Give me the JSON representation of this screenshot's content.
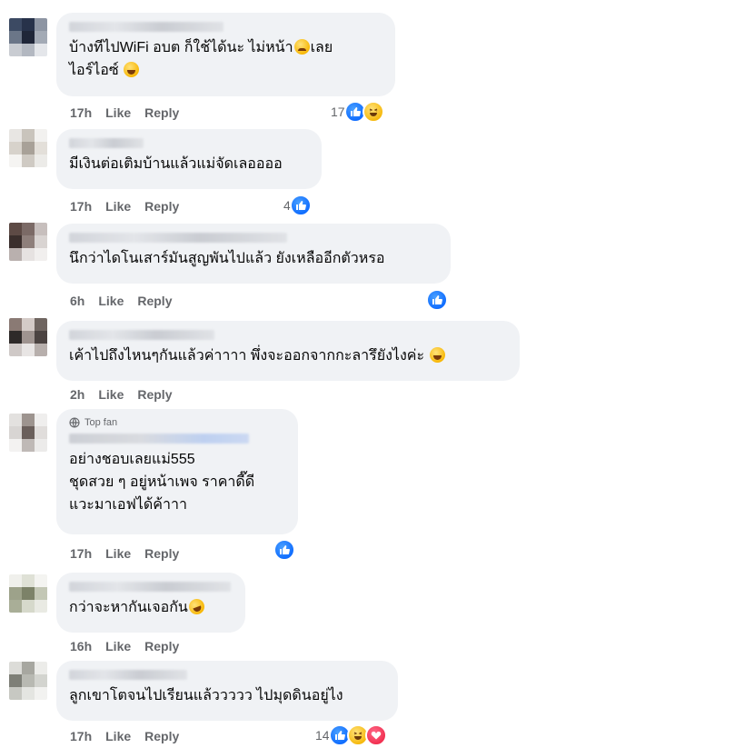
{
  "labels": {
    "like": "Like",
    "reply": "Reply",
    "top_fan": "Top fan"
  },
  "comments": [
    {
      "text_lines": [
        "บ้างทีไปWiFi อบต ก็ใช้ได้นะ ไม่หน้า",
        "เลย",
        "ไอร์ไอซ์ "
      ],
      "time": "17h",
      "reaction_count": "17",
      "reactions": [
        "like-icon",
        "haha-icon"
      ]
    },
    {
      "text_lines": [
        "มีเงินต่อเติมบ้านแล้วแม่จัดเลออออ"
      ],
      "time": "17h",
      "reaction_count": "4",
      "reactions": [
        "like-icon"
      ]
    },
    {
      "text_lines": [
        "นึกว่าไดโนเสาร์มันสูญพันไปแล้ว ยังเหลืออีกตัวหรอ"
      ],
      "time": "6h",
      "reaction_count": "",
      "reactions": [
        "like-icon"
      ]
    },
    {
      "text_lines": [
        "เค้าไปถึงไหนๆกันแล้วค่าาาา  พึ่งจะออกจากกะลารึยังไงค่ะ "
      ],
      "time": "2h",
      "reaction_count": "",
      "reactions": []
    },
    {
      "text_lines": [
        "อย่างชอบเลยแม่555",
        "ชุดสวย ๆ อยู่หน้าเพจ ราคาดี๊ดี",
        "แวะมาเอฟได้ค้าาา"
      ],
      "time": "17h",
      "reaction_count": "",
      "reactions": [
        "like-icon"
      ],
      "top_fan": true
    },
    {
      "text_lines": [
        "กว่าจะหากันเจอกัน"
      ],
      "time": "16h",
      "reaction_count": "",
      "reactions": []
    },
    {
      "text_lines": [
        "ลูกเขาโตจนไปเรียนแล้ววววว ไปมุดดินอยู่ไง"
      ],
      "time": "17h",
      "reaction_count": "14",
      "reactions": [
        "like-icon",
        "haha-icon",
        "love-icon"
      ]
    }
  ],
  "colors": {
    "bubble": "#f0f2f5",
    "meta": "#65676b",
    "like_blue": "#0866ff"
  }
}
